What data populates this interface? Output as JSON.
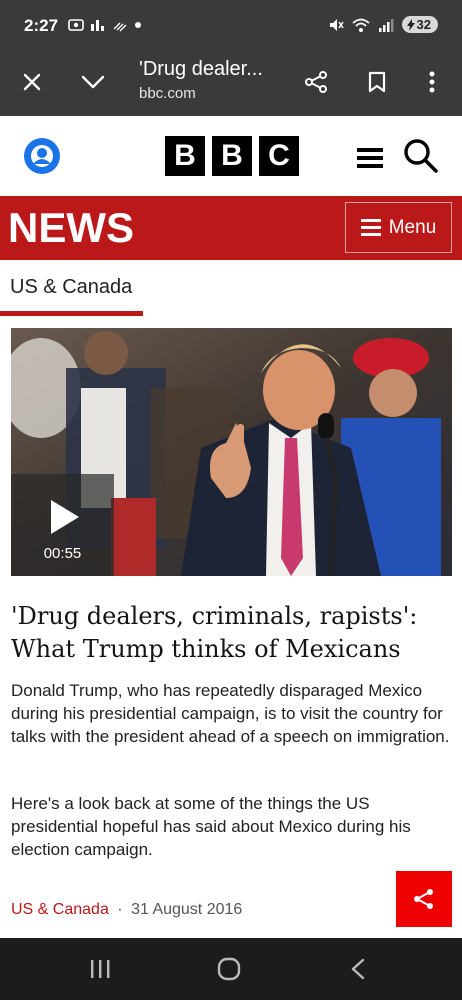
{
  "status_bar": {
    "time": "2:27",
    "battery": "32",
    "left_icons": [
      "screenshot-icon",
      "chart-icon",
      "wifi-calling-icon",
      "dot-icon"
    ],
    "right_icons": [
      "mute-icon",
      "wifi-icon",
      "signal-icon"
    ]
  },
  "browser": {
    "title": "'Drug dealer...",
    "url": "bbc.com",
    "icons": [
      "close-icon",
      "chevron-down-icon",
      "share-icon",
      "bookmark-icon",
      "more-icon"
    ]
  },
  "bbc_header": {
    "logo": [
      "B",
      "B",
      "C"
    ],
    "icons": [
      "account-icon",
      "hamburger-icon",
      "search-icon"
    ]
  },
  "news_bar": {
    "title": "NEWS",
    "menu_label": "Menu"
  },
  "section_tab": "US & Canada",
  "video": {
    "duration": "00:55"
  },
  "article": {
    "headline": "'Drug dealers, criminals, rapists': What Trump thinks of Mexicans",
    "para1": "Donald Trump, who has repeatedly disparaged Mexico during his presidential campaign, is to visit the country for talks with the president ahead of a speech on immigration.",
    "para2": "Here's a look back at some of the things the US presidential hopeful has said about Mexico during his election campaign.",
    "meta_section": "US & Canada",
    "meta_separator": "·",
    "meta_date": "31 August 2016"
  },
  "colors": {
    "bbc_red": "#bb1919",
    "share_red": "#ee0000",
    "account_blue": "#1a73e8"
  }
}
